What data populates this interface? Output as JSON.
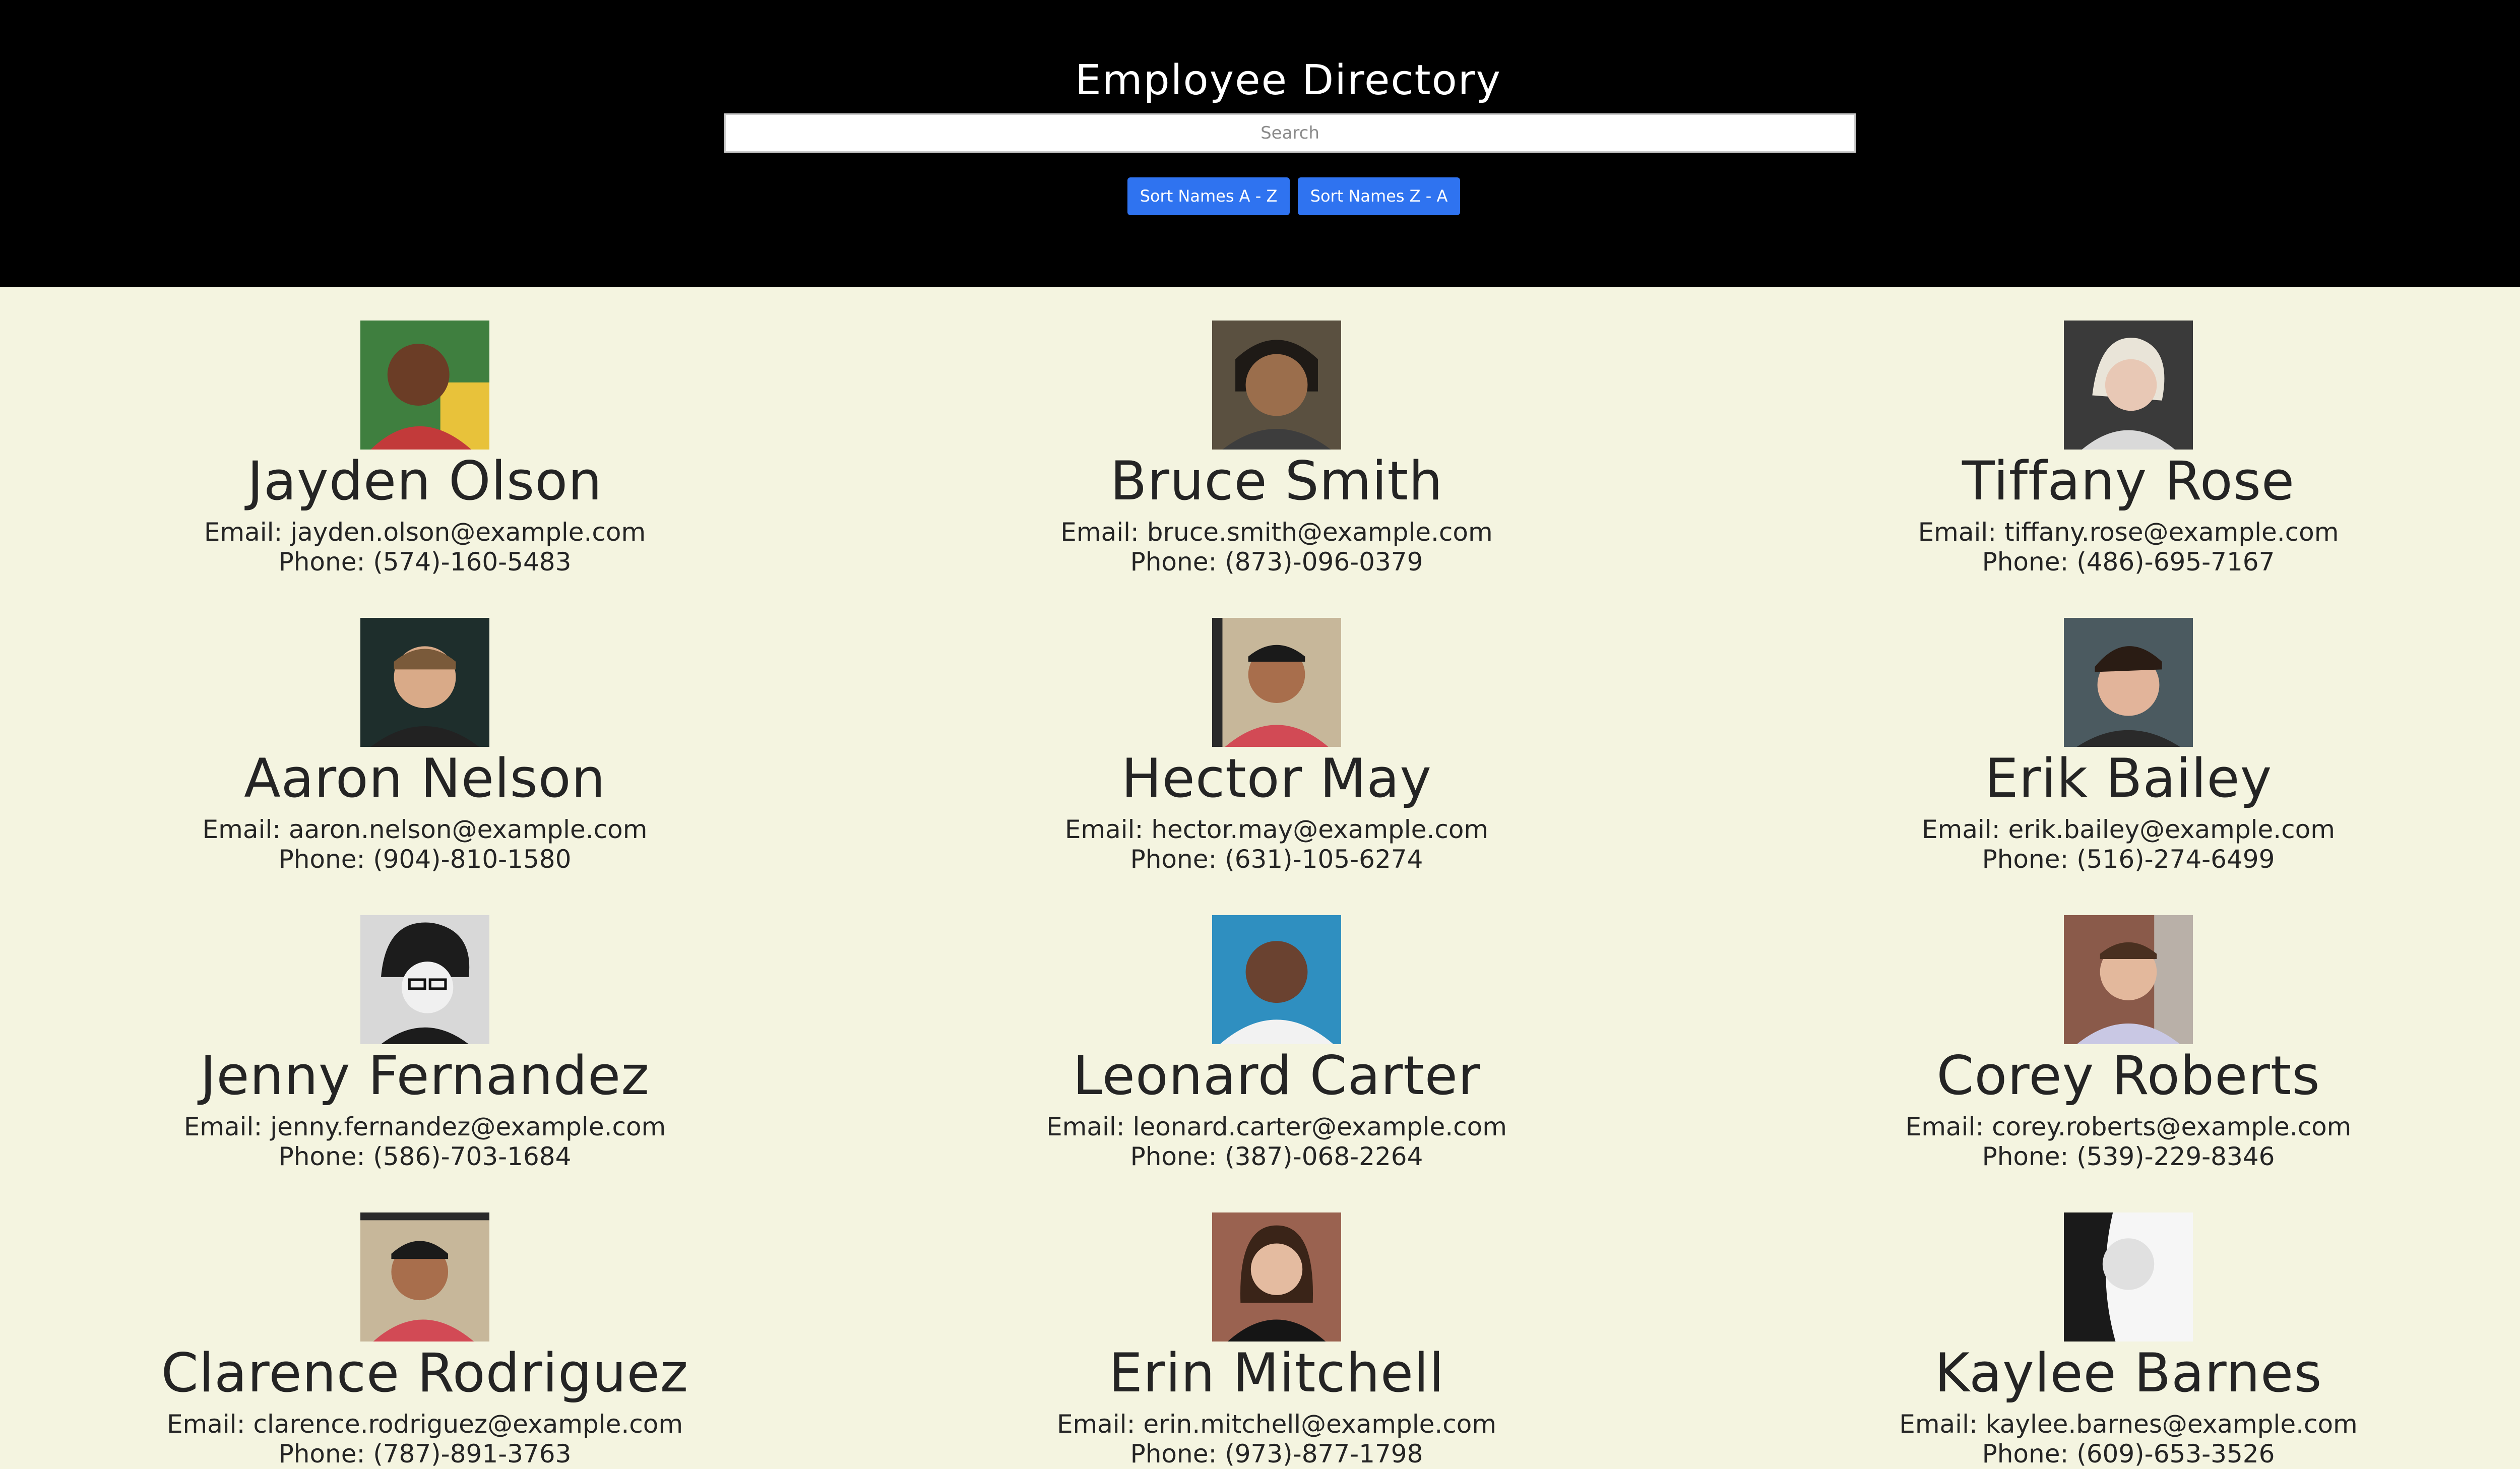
{
  "header": {
    "title": "Employee Directory",
    "search_placeholder": "Search",
    "sort_az_label": "Sort Names A - Z",
    "sort_za_label": "Sort Names Z - A"
  },
  "colors": {
    "header_bg": "#000000",
    "page_bg": "#f4f4e0",
    "button_bg": "#2f73f0",
    "text": "#242424"
  },
  "employees": [
    {
      "name": "Jayden Olson",
      "email": "Email: jayden.olson@example.com",
      "phone": "Phone: (574)-160-5483",
      "avatar": "avatar-photo",
      "skin": "#6b3d26",
      "bg": "#3f7f3f",
      "shirt": "#c23a3a"
    },
    {
      "name": "Bruce Smith",
      "email": "Email: bruce.smith@example.com",
      "phone": "Phone: (873)-096-0379",
      "avatar": "avatar-photo",
      "skin": "#9b6e4c",
      "bg": "#5a5040",
      "shirt": "#3d3d3d"
    },
    {
      "name": "Tiffany Rose",
      "email": "Email: tiffany.rose@example.com",
      "phone": "Phone: (486)-695-7167",
      "avatar": "avatar-photo",
      "skin": "#e8c8b5",
      "bg": "#3a3a3a",
      "shirt": "#d9d9d9"
    },
    {
      "name": "Aaron Nelson",
      "email": "Email: aaron.nelson@example.com",
      "phone": "Phone: (904)-810-1580",
      "avatar": "avatar-photo",
      "skin": "#d9aa88",
      "bg": "#1e2e2c",
      "shirt": "#222222"
    },
    {
      "name": "Hector May",
      "email": "Email: hector.may@example.com",
      "phone": "Phone: (631)-105-6274",
      "avatar": "avatar-photo",
      "skin": "#a86e4c",
      "bg": "#c7b79a",
      "shirt": "#d24a55"
    },
    {
      "name": "Erik Bailey",
      "email": "Email: erik.bailey@example.com",
      "phone": "Phone: (516)-274-6499",
      "avatar": "avatar-photo",
      "skin": "#e2b49a",
      "bg": "#4b5a60",
      "shirt": "#2a2a2a"
    },
    {
      "name": "Jenny Fernandez",
      "email": "Email: jenny.fernandez@example.com",
      "phone": "Phone: (586)-703-1684",
      "avatar": "avatar-photo",
      "skin": "#e6e6e6",
      "bg": "#d8d8d8",
      "shirt": "#1c1c1c"
    },
    {
      "name": "Leonard Carter",
      "email": "Email: leonard.carter@example.com",
      "phone": "Phone: (387)-068-2264",
      "avatar": "avatar-photo",
      "skin": "#6a4230",
      "bg": "#2f8fc0",
      "shirt": "#f2f2f2"
    },
    {
      "name": "Corey Roberts",
      "email": "Email: corey.roberts@example.com",
      "phone": "Phone: (539)-229-8346",
      "avatar": "avatar-photo",
      "skin": "#e3b89c",
      "bg": "#8a5a4a",
      "shirt": "#c9c8e4"
    },
    {
      "name": "Clarence Rodriguez",
      "email": "Email: clarence.rodriguez@example.com",
      "phone": "Phone: (787)-891-3763",
      "avatar": "avatar-photo",
      "skin": "#a86e4c",
      "bg": "#c7b79a",
      "shirt": "#d24a55"
    },
    {
      "name": "Erin Mitchell",
      "email": "Email: erin.mitchell@example.com",
      "phone": "Phone: (973)-877-1798",
      "avatar": "avatar-photo",
      "skin": "#e4bba0",
      "bg": "#9a6250",
      "shirt": "#151515"
    },
    {
      "name": "Kaylee Barnes",
      "email": "Email: kaylee.barnes@example.com",
      "phone": "Phone: (609)-653-3526",
      "avatar": "avatar-photo",
      "skin": "#e0e0e0",
      "bg": "#f6f6f6",
      "shirt": "#1a1a1a"
    }
  ]
}
